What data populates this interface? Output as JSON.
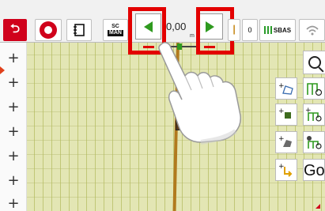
{
  "topbar": {
    "exit_icon": "exit-icon",
    "steering_icon": "steering-wheel-icon",
    "notes_icon": "notebook-icon",
    "mode_top": "SC",
    "mode_bottom": "MAN",
    "offset_value": "0,00",
    "offset_unit": "m",
    "counter_value": "0",
    "gps_label": "SBAS",
    "shift_left_icon": "arrow-left-icon",
    "shift_right_icon": "arrow-right-icon"
  },
  "left_panel": {
    "plus_labels": [
      "+",
      "+",
      "+",
      "+",
      "+",
      "+",
      "+",
      "+"
    ]
  },
  "right_panel": {
    "go_label": "Go",
    "search_icon": "search-icon"
  },
  "colors": {
    "field": "#e3e6b4",
    "accent_red": "#d0011b",
    "arrow_green": "#2f9a1f",
    "highlight_red": "#e30000",
    "guide_line": "#b17a1e"
  }
}
